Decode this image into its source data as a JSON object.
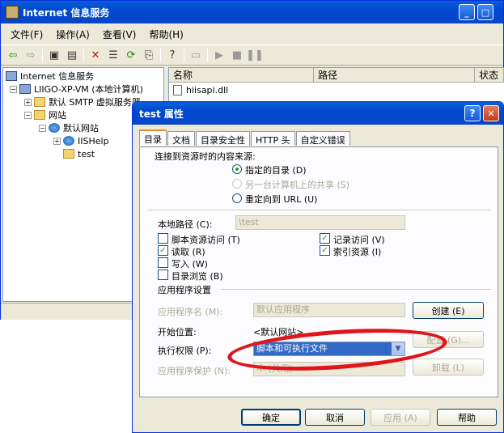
{
  "main": {
    "title": "Internet 信息服务",
    "menu": [
      "文件(F)",
      "操作(A)",
      "查看(V)",
      "帮助(H)"
    ],
    "tree": [
      {
        "label": "Internet 信息服务"
      },
      {
        "label": "LIIGO-XP-VM (本地计算机)"
      },
      {
        "label": "默认 SMTP 虚拟服务器"
      },
      {
        "label": "网站"
      },
      {
        "label": "默认网站"
      },
      {
        "label": "IISHelp"
      },
      {
        "label": "test"
      }
    ],
    "list": {
      "columns": [
        "名称",
        "路径",
        "状态"
      ],
      "rows": [
        "hiisapi.dll"
      ]
    }
  },
  "dialog": {
    "title": "test 属性",
    "tabs": [
      "目录",
      "文档",
      "目录安全性",
      "HTTP 头",
      "自定义错误"
    ],
    "source_label": "连接到资源时的内容来源:",
    "radio1": "指定的目录 (D)",
    "radio2": "另一台计算机上的共享 (S)",
    "radio3": "重定向到 URL (U)",
    "local_path_label": "本地路径 (C):",
    "local_path_value": "\\test",
    "chk_script": "脚本资源访问 (T)",
    "chk_read": "读取 (R)",
    "chk_write": "写入 (W)",
    "chk_browse": "目录浏览 (B)",
    "chk_log": "记录访问 (V)",
    "chk_index": "索引资源 (I)",
    "app_settings": "应用程序设置",
    "app_name_label": "应用程序名 (M):",
    "app_name_value": "默认应用程序",
    "start_label": "开始位置:",
    "start_value": "<默认网站>",
    "exec_label": "执行权限 (P):",
    "exec_value": "脚本和可执行文件",
    "protect_label": "应用程序保护 (N):",
    "protect_value": "中 (共用)",
    "create_btn": "创建 (E)",
    "config_btn": "配置 (G)...",
    "unload_btn": "卸载 (L)",
    "ok": "确定",
    "cancel": "取消",
    "apply": "应用 (A)",
    "help": "帮助"
  }
}
